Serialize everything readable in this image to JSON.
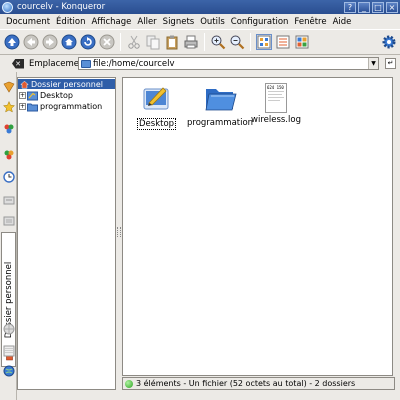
{
  "window": {
    "title": "courcelv - Konqueror",
    "controls": [
      "?",
      "_",
      "□",
      "×"
    ]
  },
  "menubar": {
    "items": [
      "Document",
      "Édition",
      "Affichage",
      "Aller",
      "Signets",
      "Outils",
      "Configuration",
      "Fenêtre",
      "Aide"
    ]
  },
  "toolbar": {
    "buttons": [
      "up-arrow-icon",
      "back-arrow-icon",
      "forward-arrow-icon",
      "home-icon",
      "reload-icon",
      "stop-icon",
      "cut-icon",
      "copy-icon",
      "paste-icon",
      "print-icon",
      "zoom-in-icon",
      "zoom-out-icon",
      "icon-view-icon",
      "detail-view-icon",
      "tree-view-icon",
      "konqueror-gear-icon"
    ]
  },
  "location": {
    "label": "Emplacement :",
    "value": "file:/home/courcelv",
    "clear_glyph": "✕",
    "go_glyph": "↵"
  },
  "sidebar_tab": {
    "label": "Dossier personnel"
  },
  "tree": {
    "root": "Dossier personnel",
    "items": [
      {
        "label": "Desktop",
        "expander": "+"
      },
      {
        "label": "programmation",
        "expander": "+"
      }
    ]
  },
  "files": [
    {
      "name": "Desktop",
      "kind": "desktop-folder",
      "selected": true
    },
    {
      "name": "programmation",
      "kind": "folder",
      "selected": false
    },
    {
      "name": "wireless.log",
      "kind": "text-file",
      "selected": false,
      "preview": "624 150"
    }
  ],
  "status": {
    "text": "3 éléments - Un fichier (52 octets au total) - 2 dossiers"
  },
  "colors": {
    "titlebar": "#2f5a9e",
    "selection": "#2f5ea8",
    "folder_blue": "#3a7bd5",
    "status_led": "#2aa31f"
  }
}
